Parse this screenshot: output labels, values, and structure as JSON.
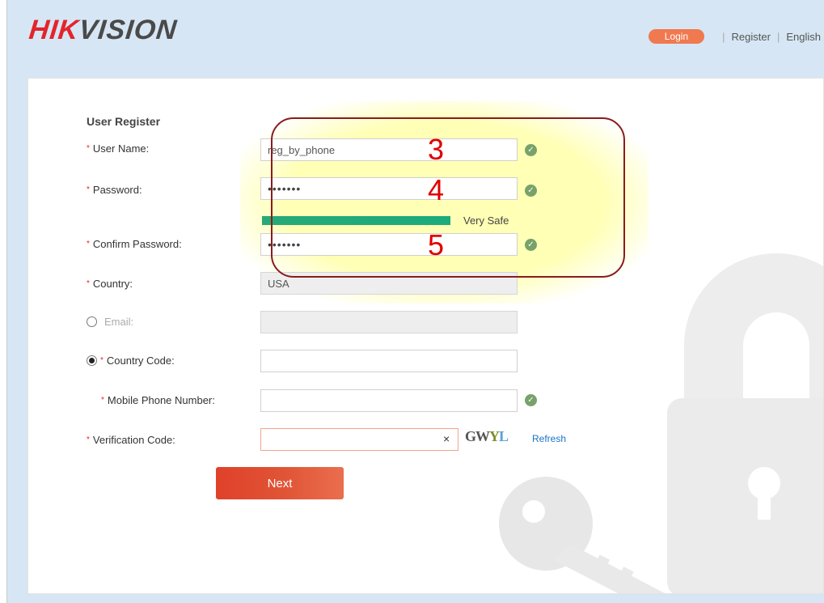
{
  "header": {
    "logo_hik": "HIK",
    "logo_vision": "VISION",
    "nav": {
      "login": "Login",
      "register": "Register",
      "language": "English",
      "separator": "|"
    }
  },
  "form": {
    "title": "User Register",
    "user_name": {
      "label": "User Name:",
      "value": "reg_by_phone",
      "required_mark": "*"
    },
    "password": {
      "label": "Password:",
      "value": "•••••••",
      "required_mark": "*"
    },
    "strength": {
      "label": "Very Safe",
      "level": 1.0,
      "color": "#1bab7d"
    },
    "confirm_password": {
      "label": "Confirm Password:",
      "value": "•••••••",
      "required_mark": "*"
    },
    "country": {
      "label": "Country:",
      "value": "USA",
      "required_mark": "*"
    },
    "email": {
      "label": "Email:",
      "value": "",
      "selected": false
    },
    "country_code": {
      "label": "Country Code:",
      "value": "",
      "selected": true,
      "required_mark": "*"
    },
    "mobile_phone": {
      "label": "Mobile Phone Number:",
      "value": "",
      "required_mark": "*"
    },
    "verification_code": {
      "label": "Verification Code:",
      "value": "",
      "required_mark": "*",
      "clear_icon": "×",
      "captcha_text": [
        "GW",
        "Y",
        "L"
      ],
      "refresh_label": "Refresh"
    },
    "next_label": "Next",
    "check_icon": "✓"
  },
  "annotations": {
    "step_3": "3",
    "step_4": "4",
    "step_5": "5",
    "box_color": "#8a1c1c",
    "number_color": "#e00000"
  }
}
